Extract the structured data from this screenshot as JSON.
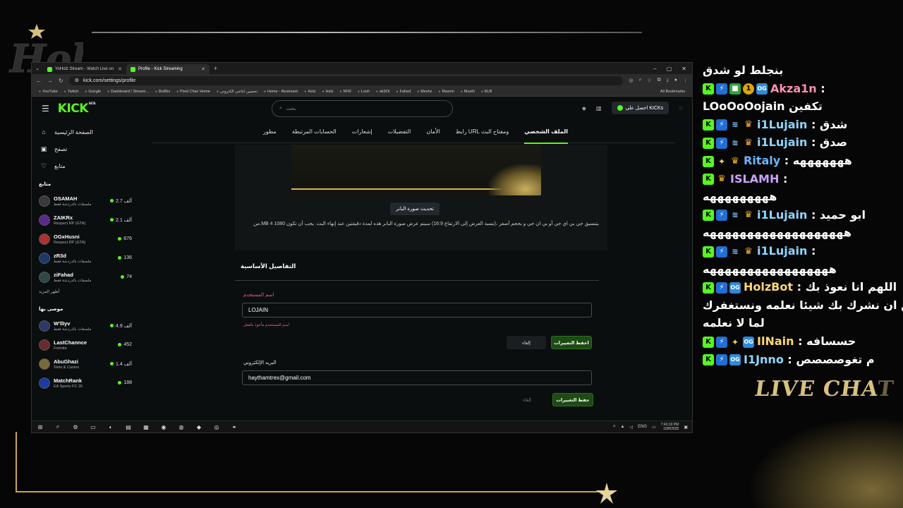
{
  "browser": {
    "tabs": [
      {
        "title": "YoHolz Stream - Watch Live on"
      },
      {
        "title": "Profile - Kick Streaming"
      }
    ],
    "url": "kick.com/settings/profile",
    "bookmarks": [
      "YouTube",
      "Twitch",
      "Google",
      "Dashboard / Stream...",
      "BotRix",
      "Pixel Chat: Home",
      "تحسين انتاجي الكتروني",
      "Home - Restream",
      "Holz",
      "Holz",
      "NFR",
      "Losh",
      "ak9OI",
      "Fahed",
      "Meshz",
      "Rwerm",
      "Musth",
      "BLB"
    ],
    "all_bookmarks": "All Bookmarks"
  },
  "kick": {
    "logo": "KICK",
    "beta": "BETA",
    "search_placeholder": "بحث",
    "get_kicks": "احصل على KICKs",
    "sidebar": {
      "nav": [
        {
          "label": "الصفحة الرئيسية",
          "icon": "home-icon"
        },
        {
          "label": "تصفح",
          "icon": "browse-icon"
        },
        {
          "label": "متابع",
          "icon": "heart-icon"
        }
      ],
      "following_heading": "متابع",
      "following": [
        {
          "name": "OSAMAH",
          "category": "ملصقات بالدردشة فقط",
          "viewers": "2.7 ألف"
        },
        {
          "name": "ZAIKRx",
          "category": "Respect RP (GTA)",
          "viewers": "2.1 ألف"
        },
        {
          "name": "OGxHusni",
          "category": "Respect RP (GTA)",
          "viewers": "676"
        },
        {
          "name": "zR3d",
          "category": "ملصقات بالدردشة فقط",
          "viewers": "136"
        },
        {
          "name": "ziFahad",
          "category": "ملصقات بالدردشة فقط",
          "viewers": "74"
        }
      ],
      "show_more": "أظهر المزيد",
      "recommended_heading": "موصى بها",
      "recommended": [
        {
          "name": "W'llIyv",
          "category": "ملصقات بالدردشة فقط",
          "viewers": "4.9 ألف"
        },
        {
          "name": "LastChannce",
          "category": "Fortnite",
          "viewers": "452"
        },
        {
          "name": "AbuGhazi",
          "category": "Slots & Casino",
          "viewers": "1.4 ألف"
        },
        {
          "name": "MatchRank",
          "category": "EA Sports FC 26",
          "viewers": "188"
        }
      ]
    },
    "settings_tabs": [
      {
        "label": "الملف الشخصي",
        "active": true
      },
      {
        "label": "رابط URL ومفتاح البث",
        "active": false
      },
      {
        "label": "الأمان",
        "active": false
      },
      {
        "label": "التفضيلات",
        "active": false
      },
      {
        "label": "إشعارات",
        "active": false
      },
      {
        "label": "الحسابات المرتبطة",
        "active": false
      },
      {
        "label": "مطور",
        "active": false
      }
    ],
    "banner": {
      "update_button": "تحديث صورة البانر",
      "hint": "بتنسيق جي بي اي جي أو بي ان جي و بحجم أصغر ،(نسبة العرض إلى الارتفاع 16:9) سيتم عرض صورة البانر هذه لمدة دقيقتين عند إنهاء البث. يجب أن تكون 1080 4 MB.من"
    },
    "basic_details": {
      "title": "التفاصيل الأساسية",
      "username_label": "اسم المستخدم",
      "username_value": "LOJAIN",
      "username_error": "اسم المستخدم مأخوذ بالفعل",
      "cancel": "إلغاء",
      "save": "احفظ التغييرات",
      "email_label": "البريد الإلكتروني",
      "email_value": "haythamtrex@gmail.com",
      "email_cancel": "إلغاء",
      "email_save": "حفظ التغييرات"
    }
  },
  "taskbar": {
    "lang": "ENG",
    "time": "7:43:10 PM",
    "date": "10/8/2025"
  },
  "chat": {
    "messages": [
      {
        "user": "",
        "text": "بنجلط لو شدق",
        "badges": []
      },
      {
        "user": "Akza1n",
        "text": ":",
        "badges": [
          "k",
          "bolt",
          "gift",
          "one",
          "og"
        ],
        "color": "pink"
      },
      {
        "user": "",
        "text": "LOoOoOojain تكفين",
        "badges": []
      },
      {
        "user": "i1Lujain",
        "text": ": شدق",
        "badges": [
          "k",
          "bolt",
          "wing",
          "crown"
        ],
        "color": "cyan"
      },
      {
        "user": "i1Lujain",
        "text": ": صدق",
        "badges": [
          "k",
          "bolt",
          "wing",
          "crown"
        ],
        "color": "cyan"
      },
      {
        "user": "Ritaly",
        "text": ": هههههههه",
        "badges": [
          "k",
          "star",
          "crown"
        ],
        "color": "blue"
      },
      {
        "user": "ISLAMH",
        "text": ":",
        "badges": [
          "k",
          "crown"
        ],
        "color": "purple"
      },
      {
        "user": "",
        "text": "هههههههههه",
        "badges": []
      },
      {
        "user": "i1Lujain",
        "text": ": ابو حميد",
        "badges": [
          "k",
          "bolt",
          "wing",
          "crown"
        ],
        "color": "cyan"
      },
      {
        "user": "",
        "text": "هههههههههههههههههههه",
        "badges": []
      },
      {
        "user": "i1Lujain",
        "text": ":",
        "badges": [
          "k",
          "bolt",
          "wing",
          "crown"
        ],
        "color": "cyan"
      },
      {
        "user": "",
        "text": "هههههههههههههههههه",
        "badges": []
      },
      {
        "user": "HolzBot",
        "text": ": اللهم انا نعوذ بك",
        "badges": [
          "k",
          "bolt",
          "og"
        ],
        "color": "gold"
      },
      {
        "user": "",
        "text": "من ان نشرك بك شيئا نعلمه ونستغفرك",
        "badges": []
      },
      {
        "user": "",
        "text": "لما لا نعلمه",
        "badges": []
      },
      {
        "user": "IlNain",
        "text": ": حسسافه",
        "badges": [
          "k",
          "bolt",
          "star",
          "og"
        ],
        "color": "gold"
      },
      {
        "user": "I1Jnno",
        "text": ": م تغوصصصص",
        "badges": [
          "k",
          "bolt",
          "og"
        ],
        "color": "cyan"
      }
    ],
    "logo_text_a": "LIVE CHA",
    "logo_text_b": "T"
  },
  "colors": {
    "kick_green": "#53fc18",
    "gold": "#c9a64a",
    "error": "#ff5b7d"
  }
}
